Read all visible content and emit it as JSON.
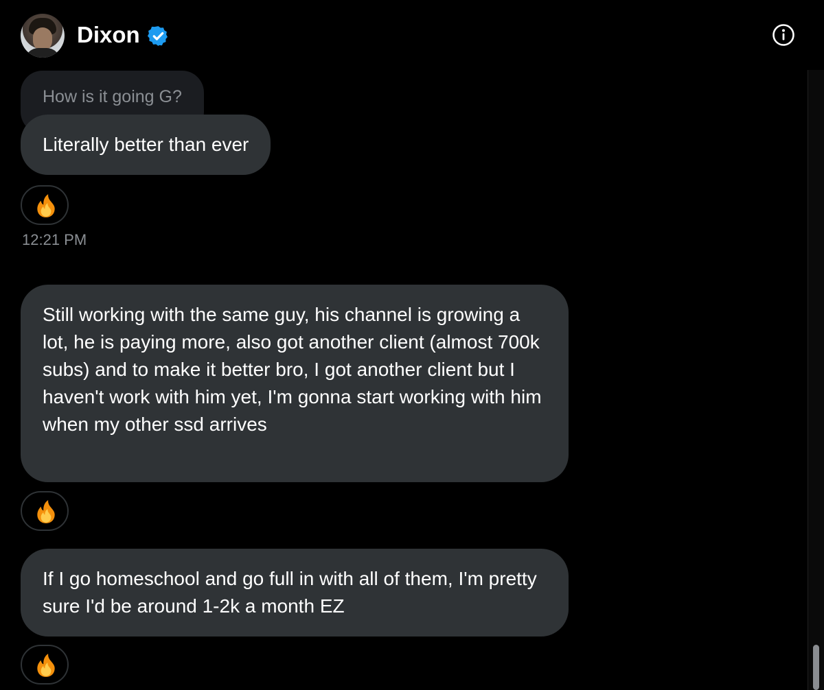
{
  "header": {
    "name": "Dixon",
    "verified_color": "#1d9bf0",
    "avatar_icon": "profile-photo",
    "info_icon": "info-circle-icon"
  },
  "conversation": {
    "quoted_message": "How is it going G?",
    "messages": [
      {
        "text": "Literally better than ever",
        "reaction": "🔥"
      },
      {
        "text": "Still working with the same guy, his channel is growing a lot, he is paying more, also got another client (almost 700k subs) and to make it better bro, I got another client but I haven't work with him yet, I'm gonna start working with him when my other ssd arrives",
        "reaction": "🔥"
      },
      {
        "text": "If I go homeschool and go full in with all of them, I'm pretty sure I'd be around 1-2k a month EZ",
        "reaction": "🔥"
      }
    ],
    "timestamp": "12:21 PM"
  },
  "colors": {
    "background": "#000000",
    "bubble": "#2f3336",
    "muted_text": "#8b8f94"
  }
}
